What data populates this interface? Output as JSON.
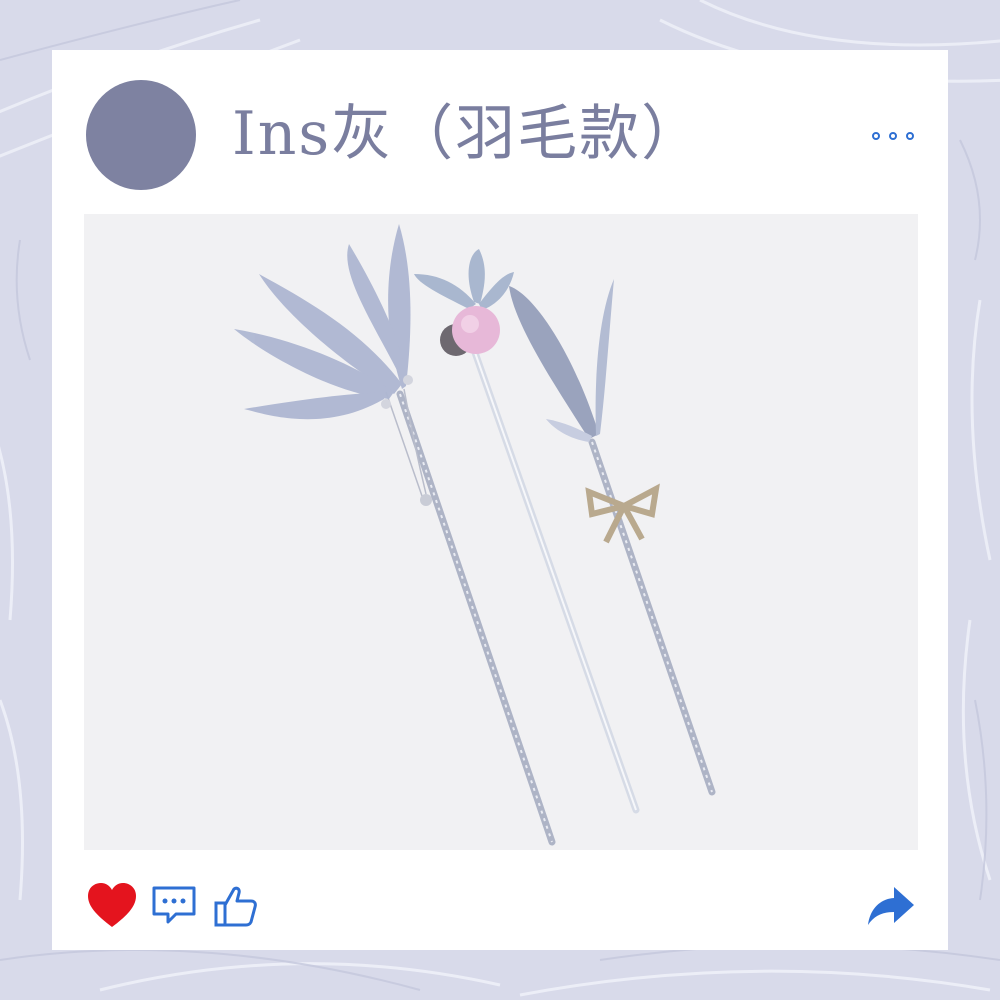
{
  "post": {
    "title": "Ins灰（羽毛款）"
  },
  "colors": {
    "avatar": "#7e82a1",
    "title": "#7a7e9f",
    "like": "#e4141e",
    "icon_blue": "#2e6fd3"
  },
  "icons": {
    "menu": "more-dots",
    "like": "heart",
    "comment": "comment-bubble",
    "thumb": "thumbs-up",
    "share": "share-arrow"
  }
}
